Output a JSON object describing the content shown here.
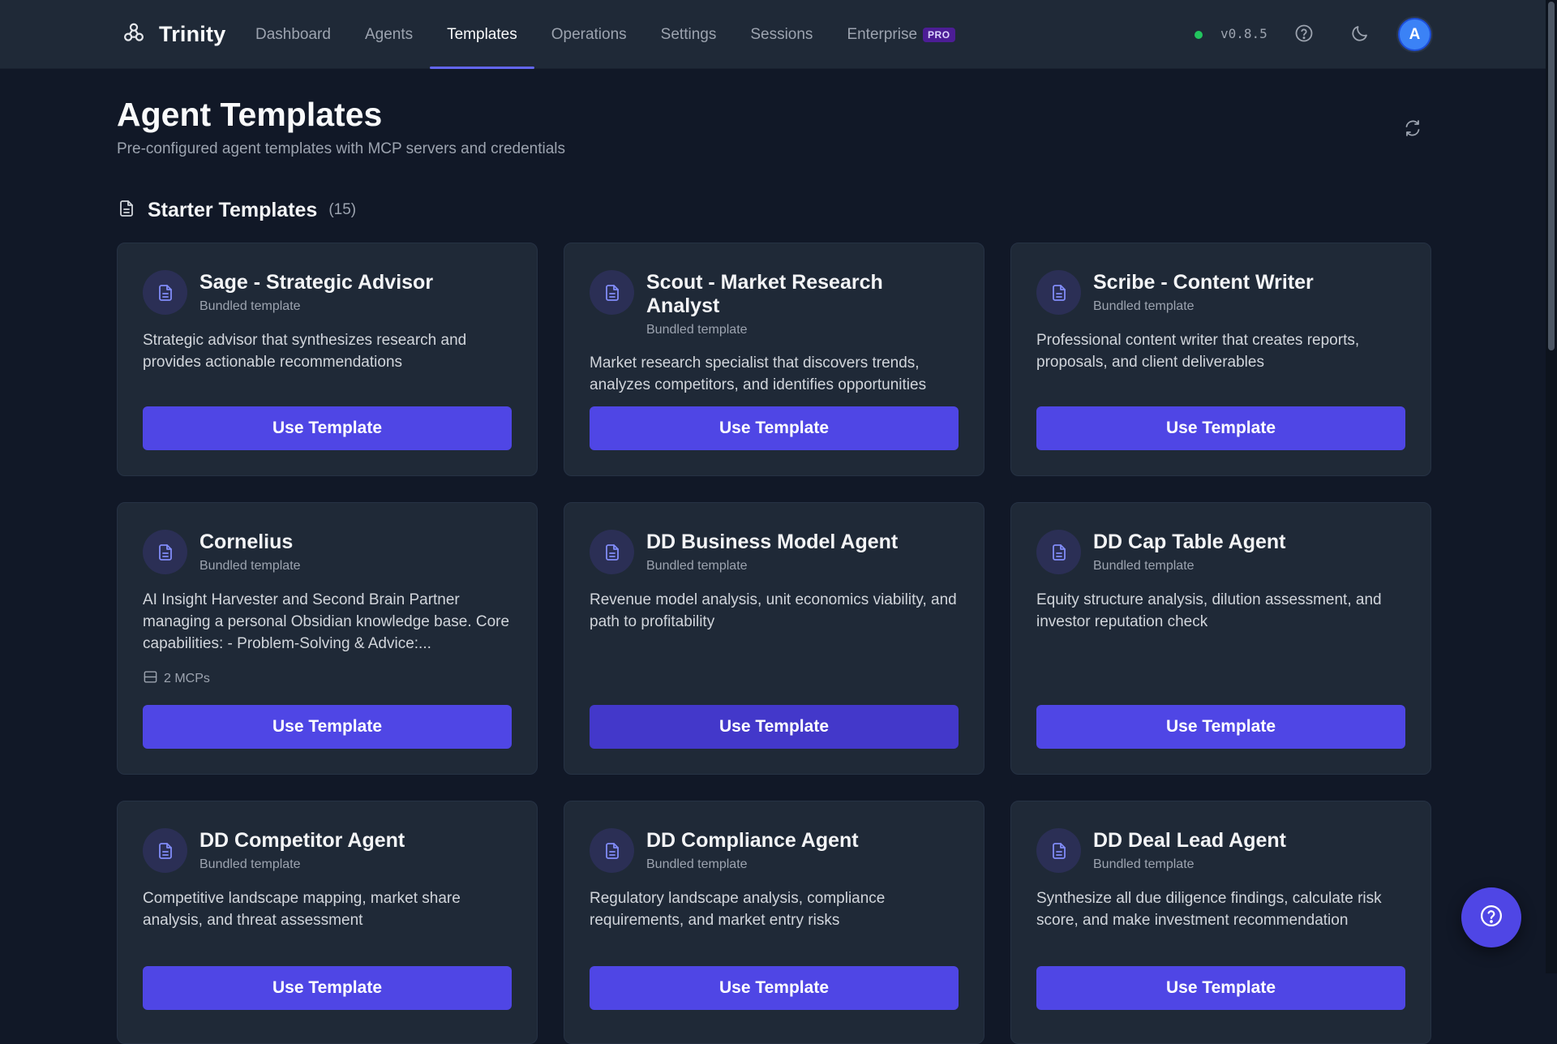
{
  "app": {
    "name": "Trinity",
    "logo_icon": "trinity-logo-icon"
  },
  "nav": {
    "items": [
      {
        "label": "Dashboard",
        "active": false
      },
      {
        "label": "Agents",
        "active": false
      },
      {
        "label": "Templates",
        "active": true
      },
      {
        "label": "Operations",
        "active": false
      },
      {
        "label": "Settings",
        "active": false
      },
      {
        "label": "Sessions",
        "active": false
      },
      {
        "label": "Enterprise",
        "active": false,
        "badge": "PRO"
      }
    ]
  },
  "header_right": {
    "status_color": "#22c55e",
    "version": "v0.8.5",
    "help_icon": "help-circle-icon",
    "theme_icon": "moon-icon",
    "avatar_initial": "A"
  },
  "page": {
    "title": "Agent Templates",
    "subtitle": "Pre-configured agent templates with MCP servers and credentials",
    "refresh_icon": "refresh-icon"
  },
  "section": {
    "title": "Starter Templates",
    "count": "(15)",
    "icon": "document-icon"
  },
  "cards": [
    {
      "title": "Sage - Strategic Advisor",
      "subtitle": "Bundled template",
      "description": "Strategic advisor that synthesizes research and provides actionable recommendations",
      "mcps": "",
      "button": "Use Template"
    },
    {
      "title": "Scout - Market Research Analyst",
      "subtitle": "Bundled template",
      "description": "Market research specialist that discovers trends, analyzes competitors, and identifies opportunities",
      "mcps": "",
      "button": "Use Template"
    },
    {
      "title": "Scribe - Content Writer",
      "subtitle": "Bundled template",
      "description": "Professional content writer that creates reports, proposals, and client deliverables",
      "mcps": "",
      "button": "Use Template"
    },
    {
      "title": "Cornelius",
      "subtitle": "Bundled template",
      "description": "AI Insight Harvester and Second Brain Partner managing a personal Obsidian knowledge base. Core capabilities: - Problem-Solving & Advice:...",
      "mcps": "2 MCPs",
      "button": "Use Template"
    },
    {
      "title": "DD Business Model Agent",
      "subtitle": "Bundled template",
      "description": "Revenue model analysis, unit economics viability, and path to profitability",
      "mcps": "",
      "button": "Use Template"
    },
    {
      "title": "DD Cap Table Agent",
      "subtitle": "Bundled template",
      "description": "Equity structure analysis, dilution assessment, and investor reputation check",
      "mcps": "",
      "button": "Use Template"
    },
    {
      "title": "DD Competitor Agent",
      "subtitle": "Bundled template",
      "description": "Competitive landscape mapping, market share analysis, and threat assessment",
      "mcps": "",
      "button": "Use Template"
    },
    {
      "title": "DD Compliance Agent",
      "subtitle": "Bundled template",
      "description": "Regulatory landscape analysis, compliance requirements, and market entry risks",
      "mcps": "",
      "button": "Use Template"
    },
    {
      "title": "DD Deal Lead Agent",
      "subtitle": "Bundled template",
      "description": "Synthesize all due diligence findings, calculate risk score, and make investment recommendation",
      "mcps": "",
      "button": "Use Template"
    }
  ],
  "fab": {
    "icon": "help-circle-icon"
  },
  "colors": {
    "accent": "#4f46e5",
    "background": "#111827",
    "surface": "#1f2937"
  }
}
